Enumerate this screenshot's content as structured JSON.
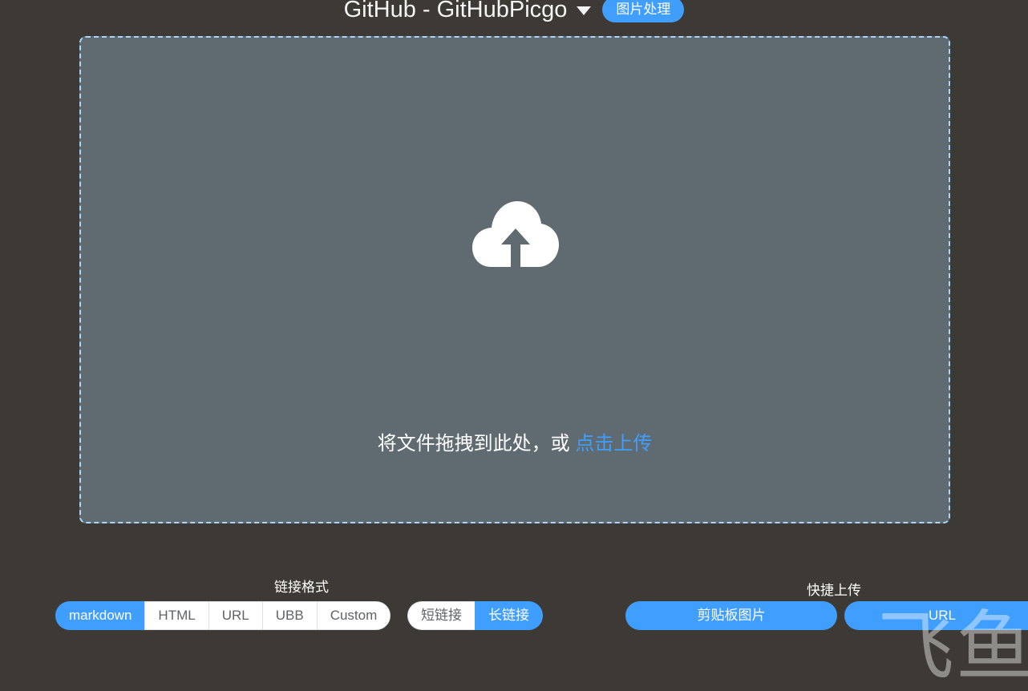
{
  "header": {
    "picbed_title": "GitHub - GitHubPicgo",
    "image_process_label": "图片处理"
  },
  "dropzone": {
    "text": "将文件拖拽到此处，或 ",
    "link": "点击上传"
  },
  "link_format": {
    "label": "链接格式",
    "formats": [
      "markdown",
      "HTML",
      "URL",
      "UBB",
      "Custom"
    ],
    "selected_format": "markdown",
    "length_options": [
      "短链接",
      "长链接"
    ],
    "selected_length": "长链接"
  },
  "quick_upload": {
    "label": "快捷上传",
    "clipboard_label": "剪贴板图片",
    "url_label": "URL"
  },
  "watermark": "飞鱼",
  "colors": {
    "accent": "#409eff",
    "background": "#3d3935",
    "dropzone": "#5f6b70"
  }
}
